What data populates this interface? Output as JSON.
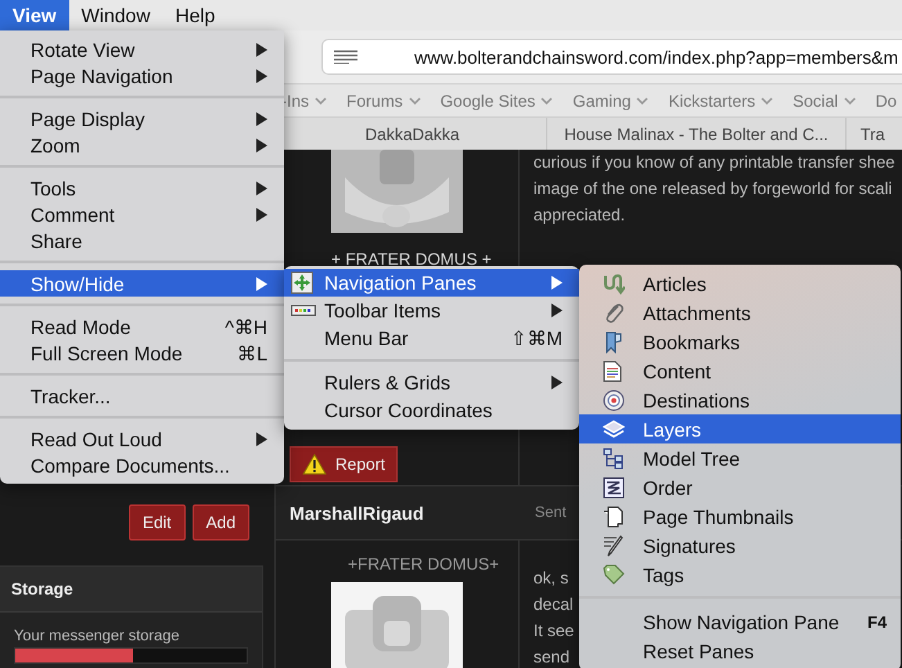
{
  "menubar": [
    {
      "label": "View",
      "selected": true
    },
    {
      "label": "Window",
      "selected": false
    },
    {
      "label": "Help",
      "selected": false
    }
  ],
  "browser": {
    "address": "www.bolterandchainsword.com/index.php?app=members&m",
    "bookmarks": [
      {
        "label": "-Ins",
        "dropdown": true
      },
      {
        "label": "Forums",
        "dropdown": true
      },
      {
        "label": "Google Sites",
        "dropdown": true
      },
      {
        "label": "Gaming",
        "dropdown": true
      },
      {
        "label": "Kickstarters",
        "dropdown": true
      },
      {
        "label": "Social",
        "dropdown": true
      },
      {
        "label": "Do",
        "dropdown": false
      }
    ],
    "tabs": [
      "DakkaDakka",
      "House Malinax - The Bolter and C...",
      "Tra"
    ]
  },
  "sidebar": {
    "buttons": [
      "Edit",
      "Add"
    ],
    "storage": {
      "title": "Storage",
      "label": "Your messenger storage",
      "level": 0.51
    }
  },
  "posts": [
    {
      "author_title": "+ FRATER DOMUS +",
      "lines": [
        "curious if you know of any printable transfer shee",
        "image of the one released by forgeworld for scali",
        "appreciated."
      ],
      "action": "Report"
    },
    {
      "author": "MarshallRigaud",
      "meta": "Sent",
      "author_title": "+FRATER DOMUS+",
      "lines": [
        "ok, s",
        "decal",
        "It see",
        "send"
      ]
    }
  ],
  "menus": [
    {
      "items": [
        {
          "kind": "item",
          "label": "Rotate View",
          "submenu": true,
          "selected": false
        },
        {
          "kind": "item",
          "label": "Page Navigation",
          "submenu": true,
          "selected": false
        },
        {
          "kind": "separator"
        },
        {
          "kind": "item",
          "label": "Page Display",
          "submenu": true,
          "selected": false
        },
        {
          "kind": "item",
          "label": "Zoom",
          "submenu": true,
          "selected": false
        },
        {
          "kind": "separator"
        },
        {
          "kind": "item",
          "label": "Tools",
          "submenu": true,
          "selected": false
        },
        {
          "kind": "item",
          "label": "Comment",
          "submenu": true,
          "selected": false
        },
        {
          "kind": "item",
          "label": "Share",
          "submenu": false,
          "selected": false
        },
        {
          "kind": "separator"
        },
        {
          "kind": "item",
          "label": "Show/Hide",
          "submenu": true,
          "selected": true
        },
        {
          "kind": "separator"
        },
        {
          "kind": "item",
          "label": "Read Mode",
          "shortcut": "^⌘H",
          "submenu": false,
          "selected": false
        },
        {
          "kind": "item",
          "label": "Full Screen Mode",
          "shortcut": "⌘L",
          "submenu": false,
          "selected": false
        },
        {
          "kind": "separator"
        },
        {
          "kind": "item",
          "label": "Tracker...",
          "submenu": false,
          "selected": false
        },
        {
          "kind": "separator"
        },
        {
          "kind": "item",
          "label": "Read Out Loud",
          "submenu": true,
          "selected": false
        },
        {
          "kind": "item",
          "label": "Compare Documents...",
          "submenu": false,
          "selected": false
        }
      ]
    },
    {
      "items": [
        {
          "kind": "item",
          "label": "Navigation Panes",
          "submenu": true,
          "selected": true
        },
        {
          "kind": "item",
          "label": "Toolbar Items",
          "submenu": true,
          "selected": false
        },
        {
          "kind": "item",
          "label": "Menu Bar",
          "shortcut": "⇧⌘M",
          "submenu": false,
          "selected": false
        },
        {
          "kind": "separator"
        },
        {
          "kind": "item",
          "label": "Rulers & Grids",
          "submenu": true,
          "selected": false
        },
        {
          "kind": "item",
          "label": "Cursor Coordinates",
          "submenu": false,
          "selected": false
        }
      ]
    },
    {
      "items": [
        {
          "kind": "item",
          "label": "Articles",
          "submenu": false,
          "selected": false
        },
        {
          "kind": "item",
          "label": "Attachments",
          "submenu": false,
          "selected": false
        },
        {
          "kind": "item",
          "label": "Bookmarks",
          "submenu": false,
          "selected": false
        },
        {
          "kind": "item",
          "label": "Content",
          "submenu": false,
          "selected": false
        },
        {
          "kind": "item",
          "label": "Destinations",
          "submenu": false,
          "selected": false
        },
        {
          "kind": "item",
          "label": "Layers",
          "submenu": false,
          "selected": true
        },
        {
          "kind": "item",
          "label": "Model Tree",
          "submenu": false,
          "selected": false
        },
        {
          "kind": "item",
          "label": "Order",
          "submenu": false,
          "selected": false
        },
        {
          "kind": "item",
          "label": "Page Thumbnails",
          "submenu": false,
          "selected": false
        },
        {
          "kind": "item",
          "label": "Signatures",
          "submenu": false,
          "selected": false
        },
        {
          "kind": "item",
          "label": "Tags",
          "submenu": false,
          "selected": false
        },
        {
          "kind": "separator"
        },
        {
          "kind": "item",
          "label": "Show Navigation Pane",
          "shortcut": "F4",
          "submenu": false,
          "selected": false
        },
        {
          "kind": "item",
          "label": "Reset Panes",
          "submenu": false,
          "selected": false
        }
      ]
    }
  ]
}
